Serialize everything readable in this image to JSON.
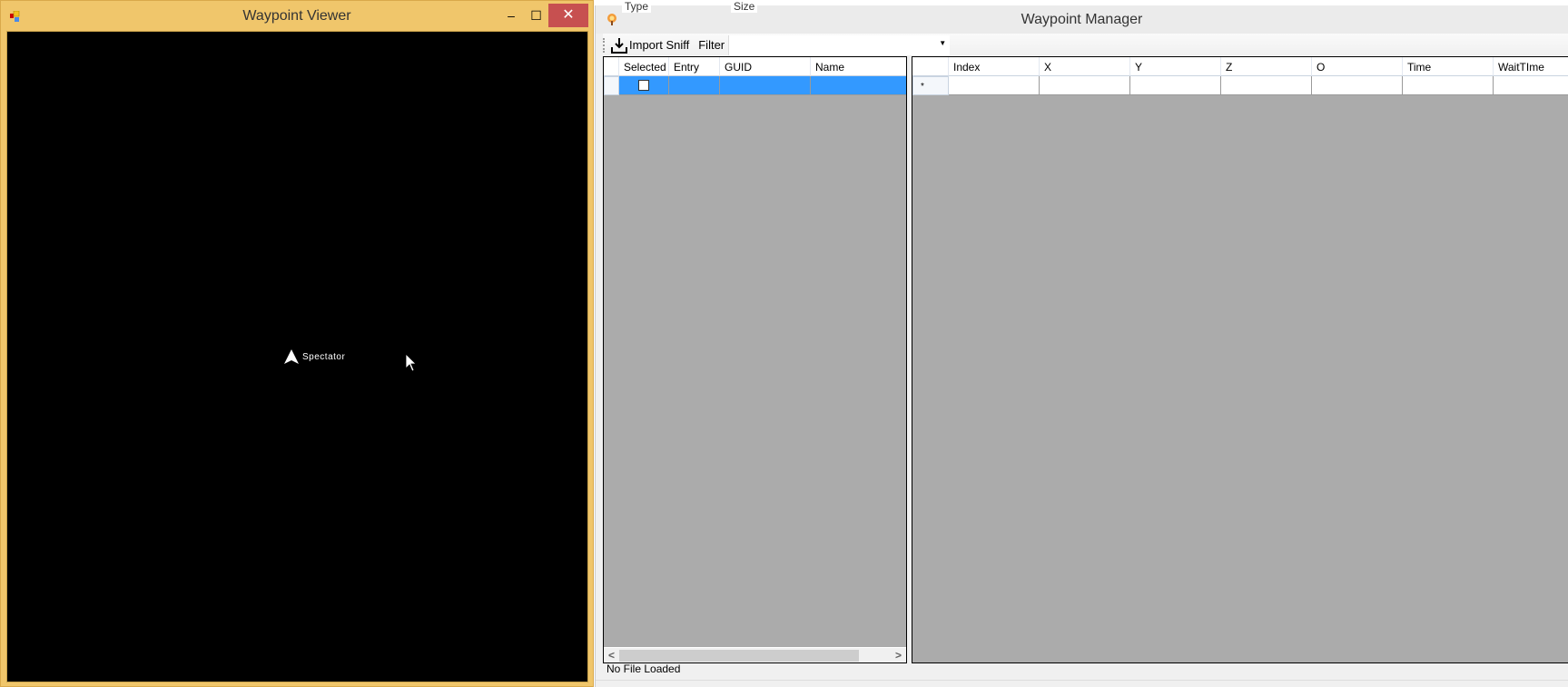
{
  "background_window": {
    "columns": [
      "Type",
      "Size"
    ]
  },
  "viewer": {
    "title": "Waypoint Viewer",
    "controls": {
      "minimize": "‒",
      "maximize": "☐",
      "close": "✕"
    },
    "canvas": {
      "marker_label": "Spectator",
      "background": "#000000"
    },
    "frame_color": "#f0c66b"
  },
  "manager": {
    "title": "Waypoint Manager",
    "toolbar": {
      "import_label": "Import Sniff",
      "filter_label": "Filter",
      "filter_value": ""
    },
    "left_grid": {
      "columns": [
        "Selected",
        "Entry",
        "GUID",
        "Name"
      ],
      "rows": [
        {
          "selected": false,
          "entry": "",
          "guid": "",
          "name": ""
        }
      ],
      "scroll_left": "<",
      "scroll_right": ">"
    },
    "right_grid": {
      "columns": [
        "Index",
        "X",
        "Y",
        "Z",
        "O",
        "Time",
        "WaitTIme"
      ],
      "new_row_marker": "*"
    },
    "status": "No File Loaded",
    "selection_color": "#3399ff"
  }
}
